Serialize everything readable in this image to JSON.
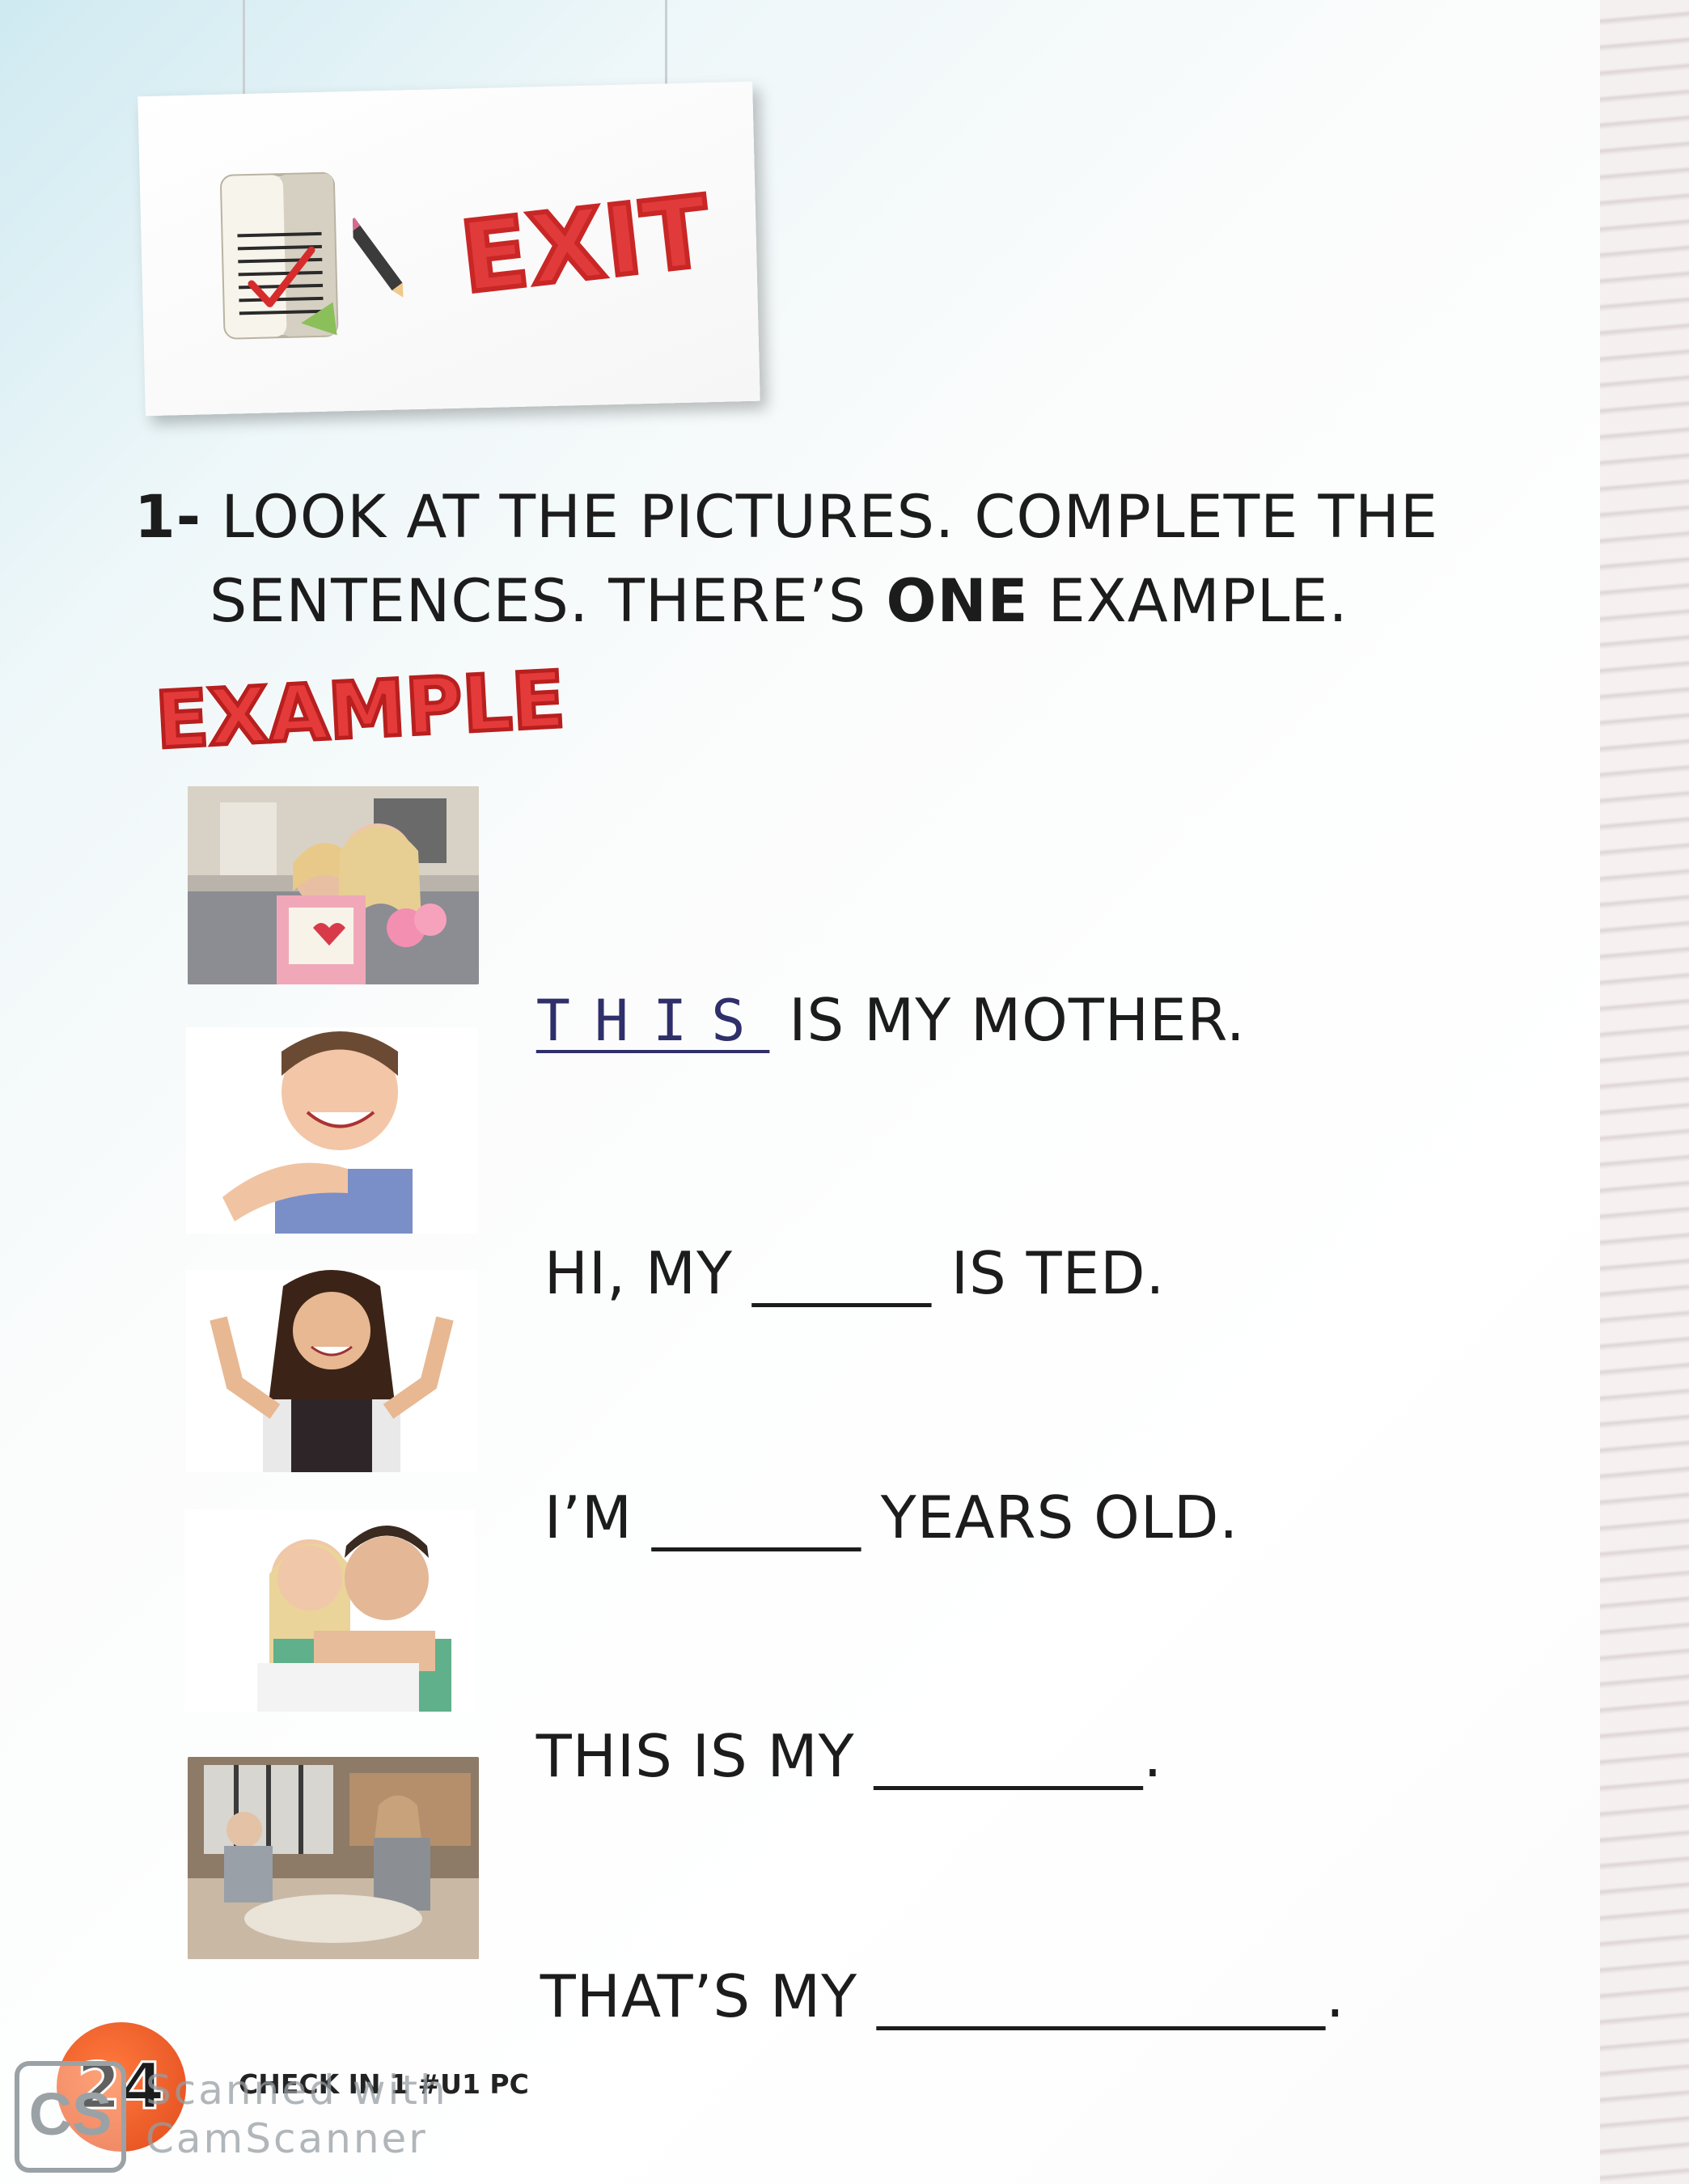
{
  "sign": {
    "label": "EXIT"
  },
  "instruction": {
    "number": "1-",
    "line1": "LOOK AT THE PICTURES. COMPLETE THE",
    "line2_prefix": "SENTENCES. THERE’S ",
    "line2_bold": "ONE",
    "line2_suffix": " EXAMPLE."
  },
  "example_badge": "EXAMPLE",
  "items": [
    {
      "prefix": "",
      "answer": "THIS",
      "blank": "",
      "suffix": " IS MY MOTHER."
    },
    {
      "prefix": "HI, MY ",
      "answer": "",
      "blank": "______",
      "suffix": " IS TED."
    },
    {
      "prefix": "I’M ",
      "answer": "",
      "blank": "_______",
      "suffix": " YEARS OLD."
    },
    {
      "prefix": "THIS IS MY ",
      "answer": "",
      "blank": "_________",
      "suffix": "."
    },
    {
      "prefix": "THAT’S MY ",
      "answer": "",
      "blank": "_______________",
      "suffix": "."
    }
  ],
  "footer": {
    "page_number": "24",
    "book_code": "CHECK IN 1 #U1 PC"
  },
  "watermark": {
    "logo": "CS",
    "line1": "Scanned with",
    "line2": "CamScanner"
  }
}
